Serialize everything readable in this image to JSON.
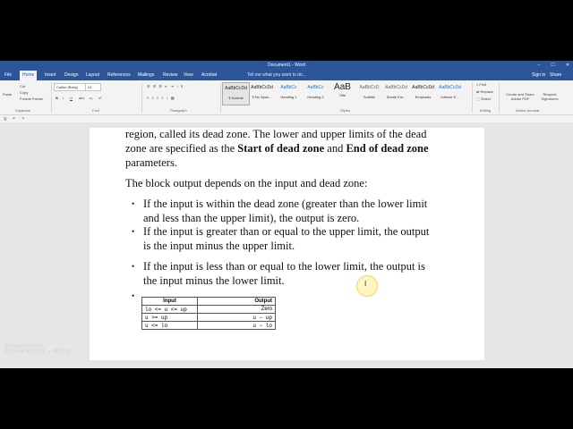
{
  "window": {
    "title": "Document1 - Word",
    "controls": [
      "−",
      "☐",
      "✕"
    ]
  },
  "tabs": [
    "File",
    "Home",
    "Insert",
    "Design",
    "Layout",
    "References",
    "Mailings",
    "Review",
    "View",
    "Acrobat"
  ],
  "tell_me": "Tell me what you want to do...",
  "account": {
    "sign_in": "Sign in",
    "share": "Share"
  },
  "ribbon": {
    "clipboard": {
      "paste": "Paste",
      "cut": "Cut",
      "copy": "Copy",
      "format_painter": "Format Painter",
      "label": "Clipboard"
    },
    "font": {
      "name": "Calibri (Body)",
      "size": "24",
      "label": "Font",
      "buttons": [
        "B",
        "I",
        "U",
        "abc",
        "x₂",
        "x²"
      ]
    },
    "paragraph": {
      "label": "Paragraph"
    },
    "styles": {
      "label": "Styles",
      "items": [
        {
          "preview": "AaBbCcDd",
          "name": "¶ Normal"
        },
        {
          "preview": "AaBbCcDd",
          "name": "¶ No Spac..."
        },
        {
          "preview": "AaBbCc",
          "name": "Heading 1"
        },
        {
          "preview": "AaBbCc",
          "name": "Heading 2"
        },
        {
          "preview": "AaB",
          "name": "Title"
        },
        {
          "preview": "AaBbCcD",
          "name": "Subtitle"
        },
        {
          "preview": "AaBbCcDd",
          "name": "Subtle Em..."
        },
        {
          "preview": "AaBbCcDd",
          "name": "Emphasis"
        },
        {
          "preview": "AaBbCcDd",
          "name": "Intense E..."
        }
      ]
    },
    "editing": {
      "find": "Find",
      "replace": "Replace",
      "select": "Select",
      "label": "Editing"
    },
    "acrobat": {
      "create_share": "Create and Share Adobe PDF",
      "request_sig": "Request Signatures",
      "label": "Adobe Acrobat"
    }
  },
  "document": {
    "para1_lines": [
      "region, called its dead zone. The lower and upper limits of the dead",
      "zone are specified as the "
    ],
    "para1_bold1": "Start of dead zone",
    "para1_and": " and ",
    "para1_bold2": "End of dead zone",
    "para1_end": "parameters.",
    "para2": "The block output depends on the input and dead zone:",
    "bullets": [
      [
        "If the input is within the dead zone (greater than the lower limit",
        "and less than the upper limit), the output is zero."
      ],
      [
        "If the input is greater than or equal to the upper limit, the output",
        "is the input minus the upper limit."
      ],
      [
        "If the input is less than or equal to the lower limit, the output is",
        "the input minus the lower limit."
      ]
    ],
    "table": {
      "headers": [
        "Input",
        "Output"
      ],
      "rows": [
        [
          "lo <= u <= up",
          "Zero"
        ],
        [
          "u >= up",
          "u − up"
        ],
        [
          "u <= lo",
          "u − lo"
        ]
      ]
    }
  },
  "watermark": {
    "line1": "RECORDED WITH",
    "line2": "SCREENCAST ◐ MATIC"
  }
}
